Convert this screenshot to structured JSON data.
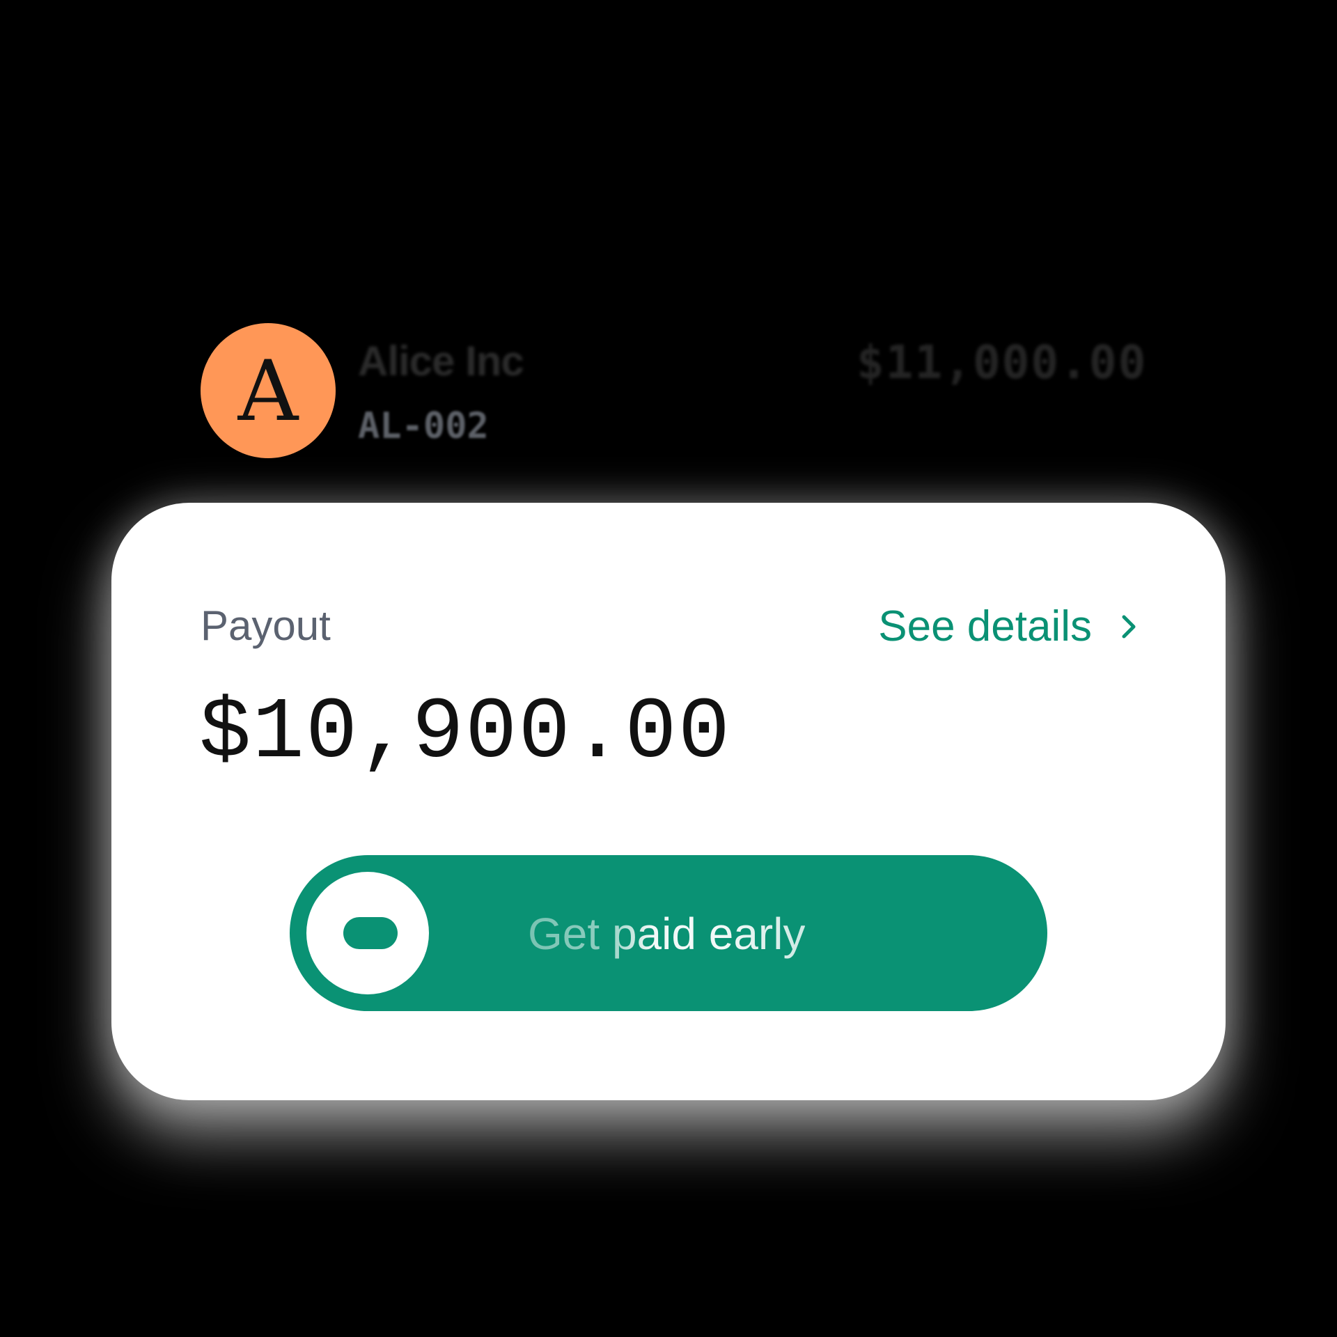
{
  "background_row": {
    "avatar_letter": "A",
    "avatar_color": "#FF9757",
    "name": "Alice Inc",
    "id": "AL-002",
    "amount": "$11,000.00"
  },
  "card": {
    "payout_label": "Payout",
    "see_details_label": "See details",
    "payout_amount": "$10,900.00",
    "slider_label": "Get paid early",
    "accent_color": "#0A9274",
    "link_color": "#0A9174"
  },
  "icons": {
    "details": "chevron-right-icon",
    "knob": "slider-knob-icon"
  }
}
